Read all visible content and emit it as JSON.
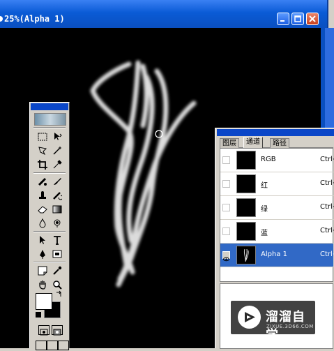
{
  "window": {
    "title": "25%(Alpha 1)",
    "buttons": [
      "minimize",
      "maximize",
      "close"
    ]
  },
  "toolbox": {
    "icons": [
      "marquee-icon",
      "move-icon",
      "lasso-icon",
      "magic-wand-icon",
      "crop-icon",
      "eyedropper-slice-icon",
      "healing-brush-icon",
      "brush-icon",
      "clone-stamp-icon",
      "history-brush-icon",
      "eraser-icon",
      "gradient-icon",
      "blur-icon",
      "dodge-icon",
      "path-select-icon",
      "type-icon",
      "pen-icon",
      "shape-icon",
      "notes-icon",
      "eyedropper-icon",
      "hand-icon",
      "zoom-icon"
    ],
    "foreground_color": "#ffffff",
    "background_color": "#000000"
  },
  "channels_panel": {
    "tabs": [
      {
        "label": "图层",
        "active": false
      },
      {
        "label": "通道",
        "active": true
      },
      {
        "label": "路径",
        "active": false
      }
    ],
    "channels": [
      {
        "name": "RGB",
        "shortcut": "Ctrl+",
        "selected": false,
        "visible": false
      },
      {
        "name": "红",
        "shortcut": "Ctrl+",
        "selected": false,
        "visible": false
      },
      {
        "name": "绿",
        "shortcut": "Ctrl+",
        "selected": false,
        "visible": false
      },
      {
        "name": "蓝",
        "shortcut": "Ctrl+",
        "selected": false,
        "visible": false
      },
      {
        "name": "Alpha 1",
        "shortcut": "Ctrl+",
        "selected": true,
        "visible": true
      }
    ],
    "selection_color": "#3169c6"
  },
  "watermark": {
    "brand": "溜溜自学",
    "url": "ZIXUE.3D66.COM"
  }
}
